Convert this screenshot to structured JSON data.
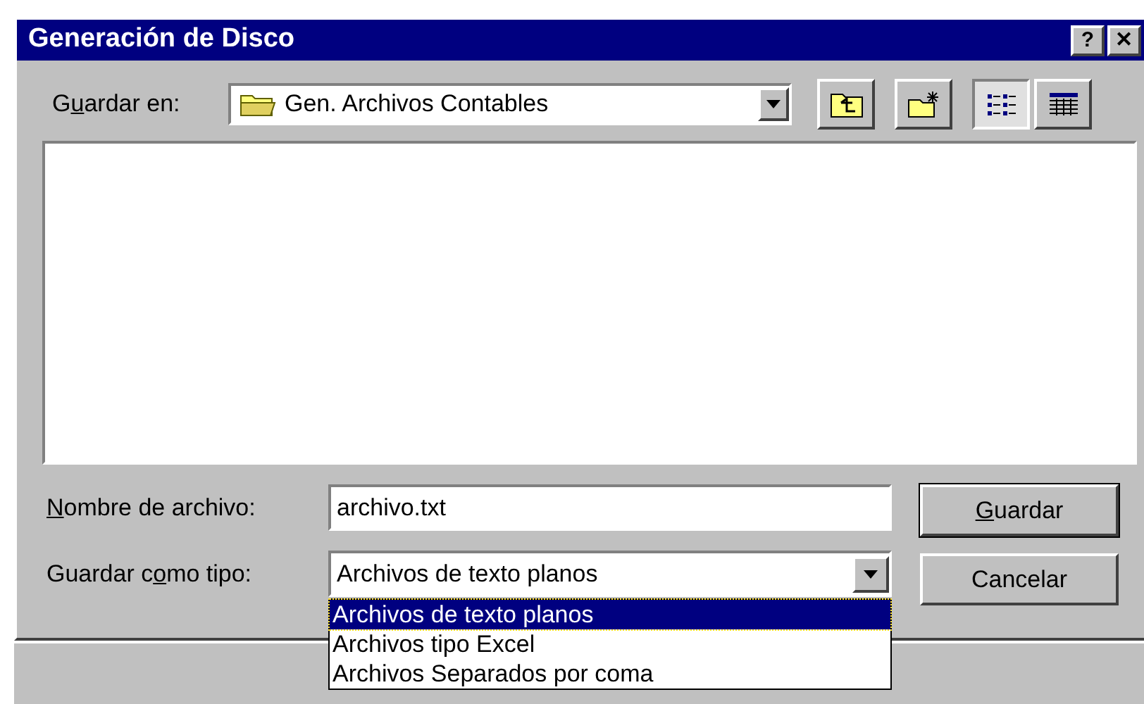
{
  "window": {
    "title": "Generación de Disco",
    "title_buttons": [
      "?",
      "✕"
    ]
  },
  "save_in": {
    "label": {
      "pre": "G",
      "key": "u",
      "post": "ardar en:"
    },
    "value": "Gen. Archivos Contables"
  },
  "toolbar": [
    {
      "kind": "up",
      "selected": false
    },
    {
      "kind": "new",
      "selected": false
    },
    {
      "kind": "list",
      "selected": true
    },
    {
      "kind": "details",
      "selected": false
    }
  ],
  "file_name": {
    "label": {
      "key": "N",
      "post": "ombre de archivo:"
    },
    "value": "archivo.txt"
  },
  "file_type": {
    "label": {
      "pre": "Guardar c",
      "key": "o",
      "post": "mo tipo:"
    },
    "value": "Archivos de texto planos",
    "expanded": true,
    "options": [
      {
        "label": "Archivos de texto planos",
        "selected": true
      },
      {
        "label": "Archivos tipo Excel",
        "selected": false
      },
      {
        "label": "Archivos Separados por coma",
        "selected": false
      }
    ]
  },
  "buttons": [
    {
      "label": {
        "key": "G",
        "post": "uardar"
      },
      "default": true
    },
    {
      "label": {
        "pre": "Cancelar"
      },
      "default": false
    }
  ]
}
